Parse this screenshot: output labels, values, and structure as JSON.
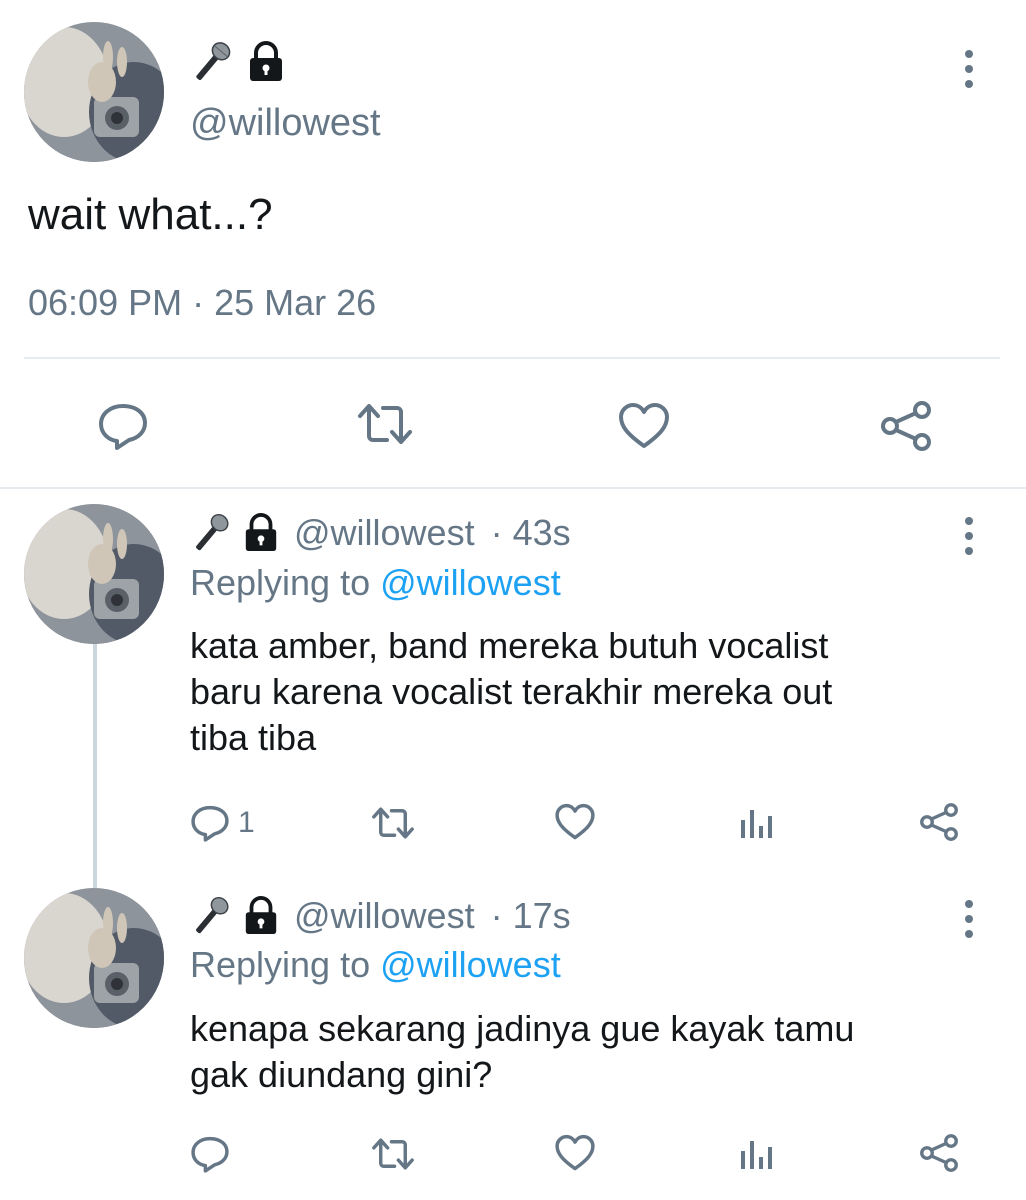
{
  "main_tweet": {
    "username": "@willowest",
    "text": "wait what...?",
    "timestamp": "06:09 PM · 25 Mar 26",
    "emoji_icons": [
      "microphone-icon",
      "lock-icon"
    ],
    "actions": [
      "reply-icon",
      "retweet-icon",
      "like-icon",
      "share-icon"
    ]
  },
  "replies": [
    {
      "username": "@willowest",
      "time": "· 43s",
      "replying_prefix": "Replying to",
      "replying_to": "@willowest",
      "text_lines": [
        "kata amber, band mereka butuh vocalist",
        "baru karena vocalist terakhir mereka out",
        "tiba tiba"
      ],
      "reply_count": "1"
    },
    {
      "username": "@willowest",
      "time": "· 17s",
      "replying_prefix": "Replying to",
      "replying_to": "@willowest",
      "text_lines": [
        "kenapa sekarang jadinya gue kayak tamu",
        "gak diundang gini?"
      ],
      "reply_count": ""
    }
  ],
  "colors": {
    "text": "#14171a",
    "muted": "#657786",
    "link": "#1da1f2",
    "divider": "#e6ecf0",
    "thread_line": "#ccd6dd"
  }
}
